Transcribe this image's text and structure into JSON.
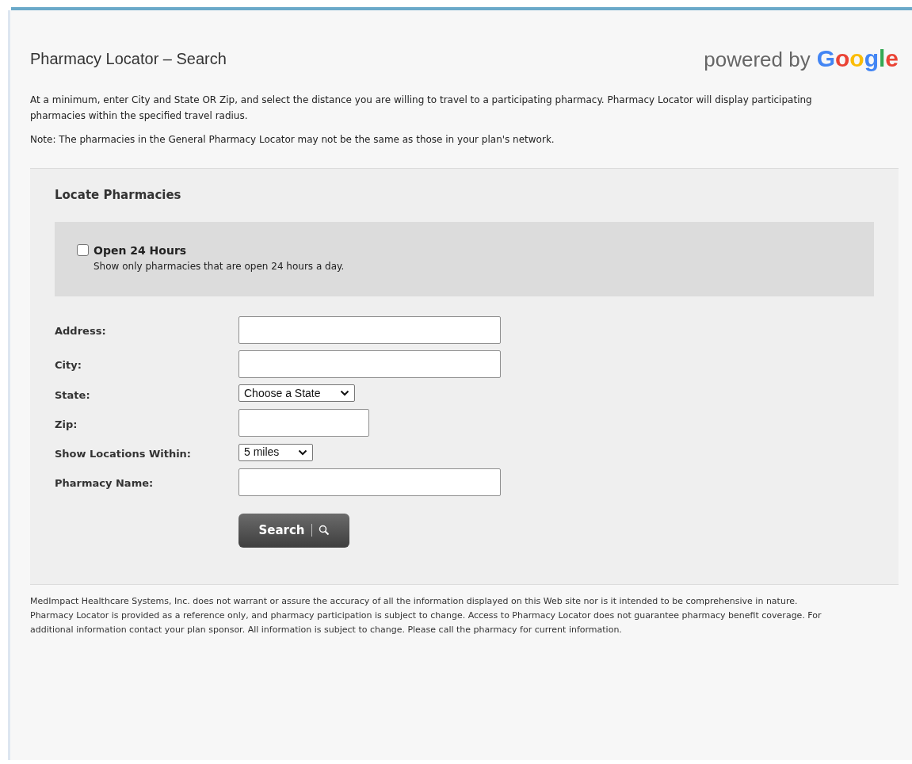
{
  "header": {
    "title": "Pharmacy Locator – Search",
    "powered_by": "powered by",
    "brand": "Google"
  },
  "intro": [
    "At a minimum, enter City and State OR Zip, and select the distance you are willing to travel to a participating pharmacy. Pharmacy Locator will display participating pharmacies within the specified travel radius.",
    "Note: The pharmacies in the General Pharmacy Locator may not be the same as those in your plan's network."
  ],
  "panel": {
    "title": "Locate Pharmacies",
    "option": {
      "label": "Open 24 Hours",
      "description": "Show only pharmacies that are open 24 hours a day.",
      "checked": false
    },
    "fields": [
      {
        "label": "Address:",
        "kind": "text"
      },
      {
        "label": "City:",
        "kind": "text"
      },
      {
        "label": "State:",
        "kind": "select",
        "value": "Choose a State"
      },
      {
        "label": "Zip:",
        "kind": "short-text"
      },
      {
        "label": "Show Locations Within:",
        "kind": "select",
        "value": "5 miles"
      },
      {
        "label": "Pharmacy Name:",
        "kind": "text"
      }
    ],
    "search_button": "Search"
  },
  "disclaimer": "MedImpact Healthcare Systems, Inc. does not warrant or assure the accuracy of all the information displayed on this Web site nor is it intended to be comprehensive in nature. Pharmacy Locator is provided as a reference only, and pharmacy participation is subject to change. Access to Pharmacy Locator does not guarantee pharmacy benefit coverage. For additional information contact your plan sponsor. All information is subject to change. Please call the pharmacy for current information."
}
